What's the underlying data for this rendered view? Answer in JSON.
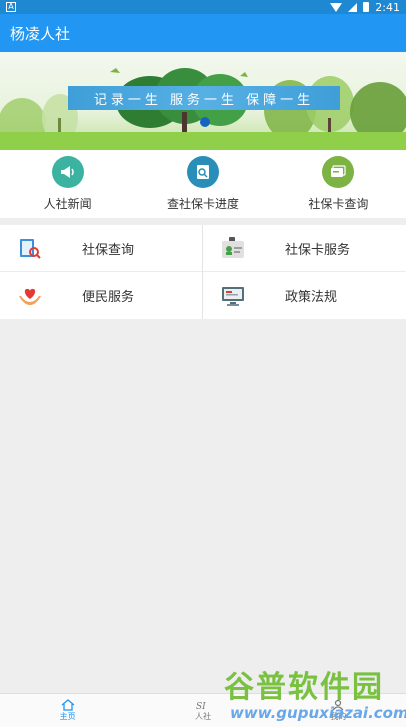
{
  "status_bar": {
    "time": "2:41",
    "left_icon": "A"
  },
  "app_bar": {
    "title": "杨凌人社"
  },
  "banner": {
    "slogan": "记录一生 服务一生 保障一生"
  },
  "quick_links": [
    {
      "label": "人社新闻",
      "icon": "megaphone-icon",
      "color": "#3bb3a0"
    },
    {
      "label": "查社保卡进度",
      "icon": "card-progress-icon",
      "color": "#2a8fb8"
    },
    {
      "label": "社保卡查询",
      "icon": "card-stack-icon",
      "color": "#7cb342"
    }
  ],
  "services": [
    {
      "label": "社保查询",
      "icon": "book-search-icon"
    },
    {
      "label": "社保卡服务",
      "icon": "id-card-icon"
    },
    {
      "label": "便民服务",
      "icon": "heart-hands-icon"
    },
    {
      "label": "政策法规",
      "icon": "monitor-icon"
    }
  ],
  "bottom_tabs": [
    {
      "label": "主页",
      "icon": "home-icon",
      "active": true
    },
    {
      "label": "人社",
      "icon": "si-logo-icon",
      "active": false
    },
    {
      "label": "我的",
      "icon": "user-icon",
      "active": false
    }
  ],
  "watermark": {
    "line1": "谷普软件园",
    "line2": "www.gupuxiazai.com"
  }
}
